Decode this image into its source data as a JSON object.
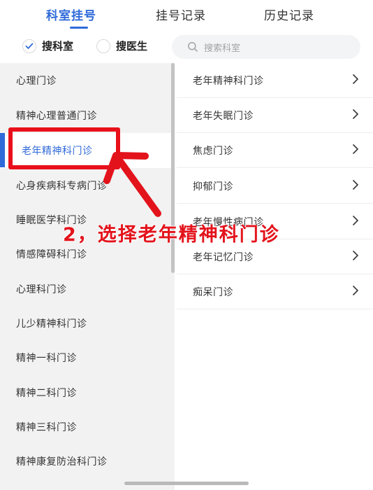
{
  "tabs": [
    {
      "label": "科室挂号",
      "active": true
    },
    {
      "label": "挂号记录",
      "active": false
    },
    {
      "label": "历史记录",
      "active": false
    }
  ],
  "search": {
    "radio_department": {
      "label": "搜科室",
      "checked": true
    },
    "radio_doctor": {
      "label": "搜医生",
      "checked": false
    },
    "placeholder": "搜索科室"
  },
  "left_list": [
    {
      "label": "心理门诊"
    },
    {
      "label": "精神心理普通门诊"
    },
    {
      "label": "老年精神科门诊",
      "selected": true
    },
    {
      "label": "心身疾病科专病门诊"
    },
    {
      "label": "睡眠医学科门诊"
    },
    {
      "label": "情感障碍科门诊"
    },
    {
      "label": "心理科门诊"
    },
    {
      "label": "儿少精神科门诊"
    },
    {
      "label": "精神一科门诊"
    },
    {
      "label": "精神二科门诊"
    },
    {
      "label": "精神三科门诊"
    },
    {
      "label": "精神康复防治科门诊"
    }
  ],
  "right_list": [
    {
      "label": "老年精神科门诊"
    },
    {
      "label": "老年失眠门诊"
    },
    {
      "label": "焦虑门诊"
    },
    {
      "label": "抑郁门诊"
    },
    {
      "label": "老年慢性病门诊"
    },
    {
      "label": "老年记忆门诊"
    },
    {
      "label": "痴呆门诊"
    }
  ],
  "annotation": {
    "text": "2，选择老年精神科门诊"
  },
  "colors": {
    "accent": "#2f6ad9",
    "annotation": "#e3131c"
  },
  "icons": {
    "search": "search-icon",
    "check": "check-icon",
    "chevron": "chevron-right-icon",
    "arrow": "annotation-arrow"
  }
}
